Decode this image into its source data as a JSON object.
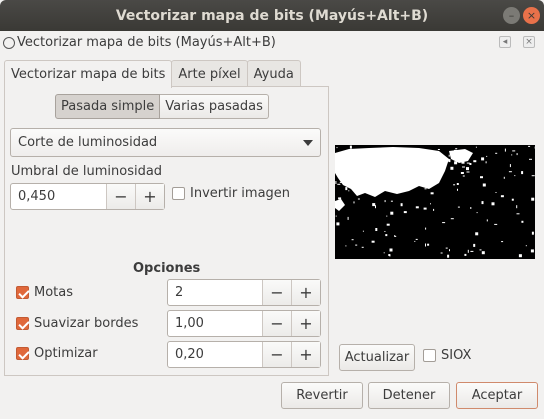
{
  "window": {
    "title": "Vectorizar mapa de bits (Mayús+Alt+B)"
  },
  "dock": {
    "title": "Vectorizar mapa de bits (Mayús+Alt+B)"
  },
  "tabs": [
    {
      "label": "Vectorizar mapa de bits",
      "active": true
    },
    {
      "label": "Arte píxel",
      "active": false
    },
    {
      "label": "Ayuda",
      "active": false
    }
  ],
  "mode": {
    "single": "Pasada simple",
    "multi": "Varias pasadas",
    "selected": "single"
  },
  "method": {
    "selected": "Corte de luminosidad"
  },
  "threshold": {
    "label": "Umbral de luminosidad",
    "value": "0,450"
  },
  "invert": {
    "label": "Invertir imagen",
    "checked": false
  },
  "options": {
    "heading": "Opciones",
    "rows": [
      {
        "label": "Motas",
        "checked": true,
        "value": "2"
      },
      {
        "label": "Suavizar bordes",
        "checked": true,
        "value": "1,00"
      },
      {
        "label": "Optimizar",
        "checked": true,
        "value": "0,20"
      }
    ]
  },
  "preview": {
    "update_label": "Actualizar",
    "siox_label": "SIOX",
    "siox_checked": false
  },
  "footer": {
    "revert": "Revertir",
    "stop": "Detener",
    "ok": "Aceptar"
  },
  "colors": {
    "accent": "#e0683b",
    "titlebar": "#3a3935"
  }
}
